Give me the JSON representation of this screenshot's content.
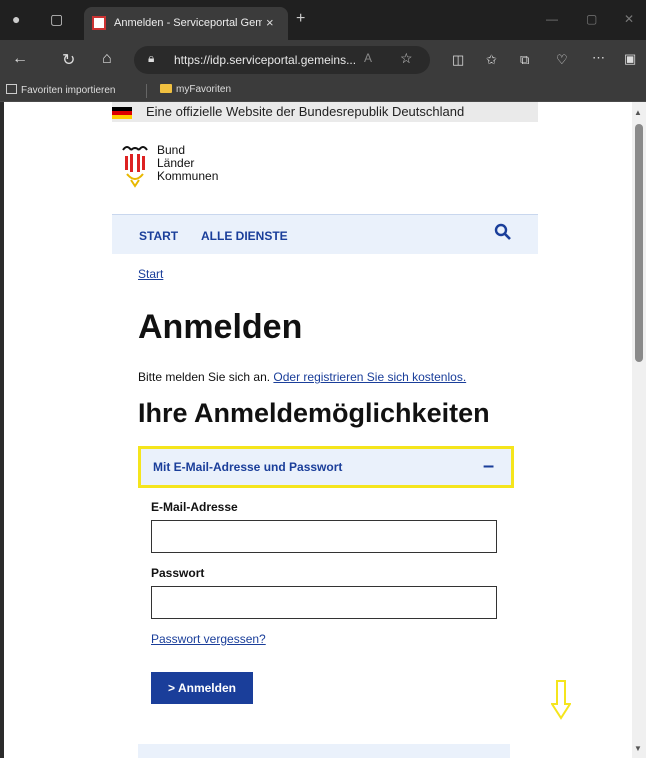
{
  "browser": {
    "tab_title": "Anmelden - Serviceportal Gemein",
    "tab_close": "×",
    "new_tab": "+",
    "url": "https://idp.serviceportal.gemeins...",
    "favorites": [
      {
        "label": "Favoriten importieren"
      },
      {
        "label": "myFavoriten"
      }
    ]
  },
  "page": {
    "gov_banner": "Eine offizielle Website der Bundesrepublik Deutschland",
    "logo_lines": [
      "Bund",
      "Länder",
      "Kommunen"
    ],
    "nav": {
      "start": "START",
      "all_services": "ALLE DIENSTE"
    },
    "breadcrumb": "Start",
    "title": "Anmelden",
    "intro_text": "Bitte melden Sie sich an. ",
    "intro_link": "Oder registrieren Sie sich kostenlos.",
    "section_title": "Ihre Anmeldemöglichkeiten",
    "accordion": {
      "label": "Mit E-Mail-Adresse und Passwort",
      "toggle": "–"
    },
    "email_label": "E-Mail-Adresse",
    "email_value": "",
    "password_label": "Passwort",
    "password_value": "",
    "forgot_link": "Passwort vergessen?",
    "login_button": "> Anmelden"
  },
  "colors": {
    "accent": "#1a3e9a",
    "highlight": "#f5e51c",
    "nav_bg": "#eaf1fb"
  }
}
